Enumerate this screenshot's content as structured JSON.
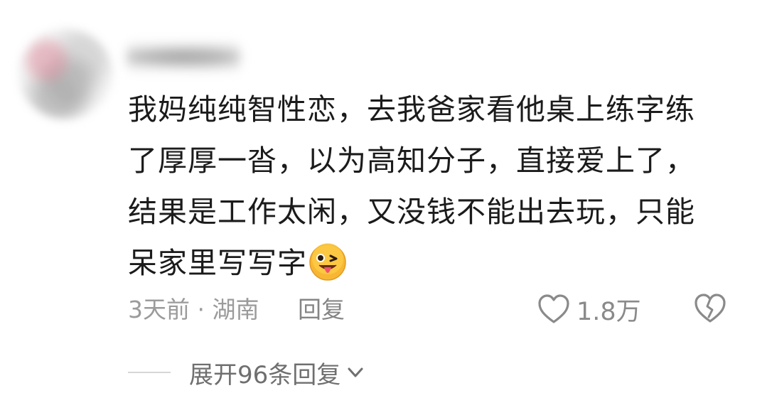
{
  "comment": {
    "text": "我妈纯纯智性恋，去我爸家看他桌上练字练了厚厚一沓，以为高知分子，直接爱上了，结果是工作太闲，又没钱不能出去玩，只能呆家里写写字",
    "emoji_icon": "wink-tongue-emoji-icon",
    "time_location": "3天前 · 湖南",
    "reply_label": "回复",
    "like_count": "1.8万",
    "expand_label": "展开96条回复",
    "colors": {
      "text": "#1b1b1b",
      "meta": "#9b9b9b",
      "icon": "#8a8a8a",
      "emoji": "#f7b733"
    }
  }
}
